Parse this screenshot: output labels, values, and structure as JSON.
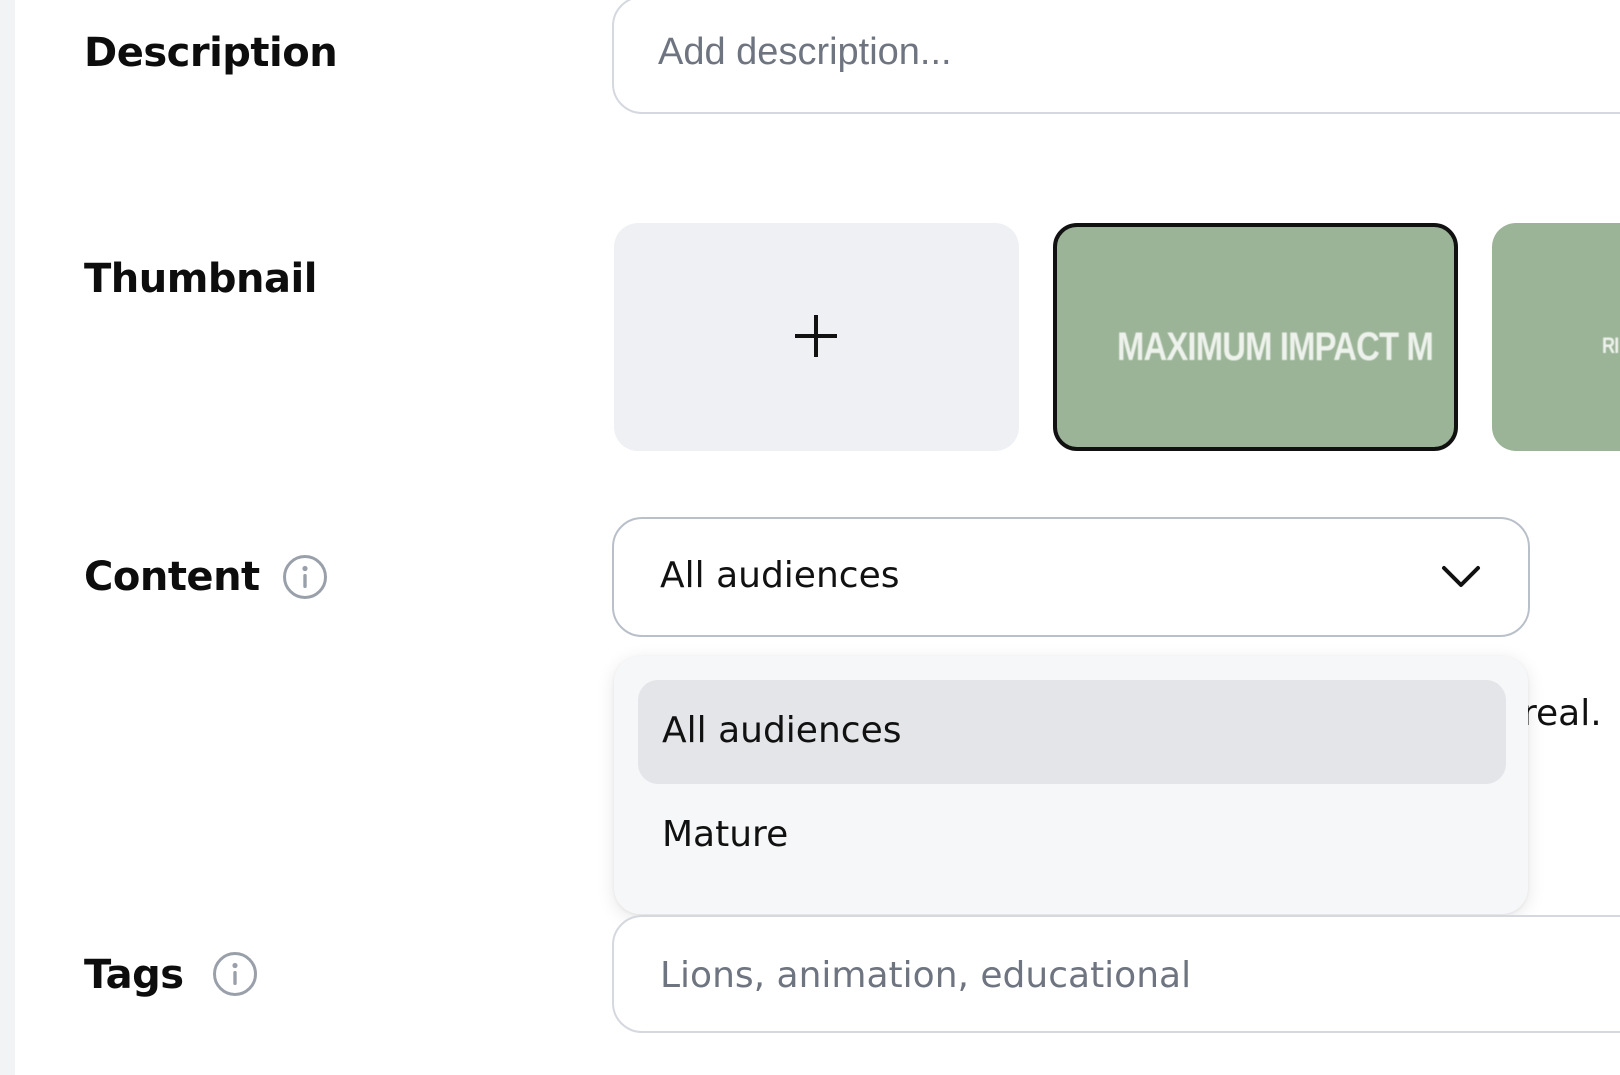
{
  "form": {
    "description": {
      "label": "Description",
      "placeholder": "Add description..."
    },
    "thumbnail": {
      "label": "Thumbnail",
      "add_icon": "plus-icon",
      "items": [
        {
          "text": "MAXIMUM IMPACT   M",
          "selected": true,
          "color": "#9bb497"
        },
        {
          "text": "RI",
          "selected": false,
          "color": "#9bb497"
        }
      ]
    },
    "content": {
      "label": "Content",
      "info_icon": "info-icon",
      "selected_value": "All audiences",
      "chevron_icon": "chevron-down-icon",
      "options": [
        "All audiences",
        "Mature"
      ],
      "partially_hidden_text": "real."
    },
    "tags": {
      "label": "Tags",
      "info_icon": "info-icon",
      "placeholder": "Lions, animation, educational"
    }
  },
  "colors": {
    "thumbnail_green": "#9bb497",
    "selected_border": "#111111",
    "menu_active_bg": "#e3e5e9",
    "placeholder_text": "#6f7580"
  }
}
